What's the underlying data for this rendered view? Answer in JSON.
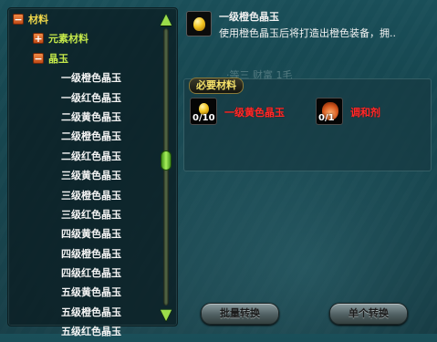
{
  "tree": {
    "items": [
      {
        "level": 0,
        "label": "材料",
        "toggle": "−"
      },
      {
        "level": 1,
        "label": "元素材料",
        "toggle": "+"
      },
      {
        "level": 1,
        "label": "晶玉",
        "toggle": "−"
      },
      {
        "level": 2,
        "label": "一级橙色晶玉"
      },
      {
        "level": 2,
        "label": "一级红色晶玉"
      },
      {
        "level": 2,
        "label": "二级黄色晶玉"
      },
      {
        "level": 2,
        "label": "二级橙色晶玉"
      },
      {
        "level": 2,
        "label": "二级红色晶玉"
      },
      {
        "level": 2,
        "label": "三级黄色晶玉"
      },
      {
        "level": 2,
        "label": "三级橙色晶玉"
      },
      {
        "level": 2,
        "label": "三级红色晶玉"
      },
      {
        "level": 2,
        "label": "四级黄色晶玉"
      },
      {
        "level": 2,
        "label": "四级橙色晶玉"
      },
      {
        "level": 2,
        "label": "四级红色晶玉"
      },
      {
        "level": 2,
        "label": "五级黄色晶玉"
      },
      {
        "level": 2,
        "label": "五级橙色晶玉"
      },
      {
        "level": 2,
        "label": "五级红色晶玉"
      }
    ]
  },
  "scrollbar": {
    "up_icon": "▲",
    "down_icon": "▼"
  },
  "detail": {
    "name": "一级橙色晶玉",
    "description": "使用橙色晶玉后将打造出橙色装备，拥..",
    "ghost_text": "·等三 财富 1毛"
  },
  "materials": {
    "title": "必要材料",
    "items": [
      {
        "name": "一级黄色晶玉",
        "count": "0/10",
        "icon": "yellow-gem-icon"
      },
      {
        "name": "调和剂",
        "count": "0/1",
        "icon": "potion-flask-icon"
      }
    ]
  },
  "buttons": {
    "batch": "批量转换",
    "single": "单个转换"
  },
  "colors": {
    "category": "#f0d84a",
    "subcategory": "#c4e84a",
    "material_name": "#ff2a2a",
    "panel_tag_text": "#f6e36a"
  }
}
